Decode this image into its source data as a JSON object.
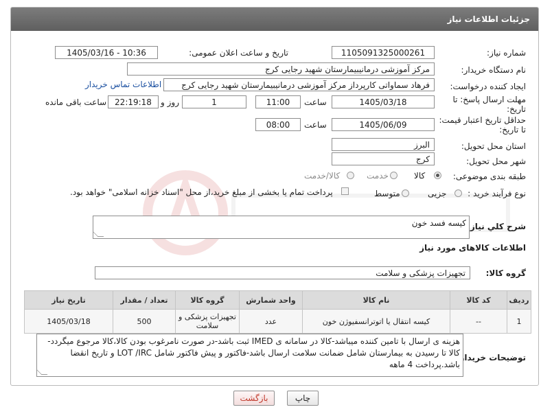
{
  "header": {
    "title": "جزئیات اطلاعات نیاز"
  },
  "fields": {
    "need_number_label": "شماره نیاز:",
    "need_number": "1105091325000261",
    "announce_label": "تاریخ و ساعت اعلان عمومی:",
    "announce_value": "1405/03/16 - 10:36",
    "buyer_label": "نام دستگاه خریدار:",
    "buyer_value": "مرکز آموزشی درمانیبیمارستان شهید رجایی کرج",
    "creator_label": "ایجاد کننده درخواست:",
    "creator_value": "فرهاد سماواتی کارپرداز مرکز آموزشی درمانیبیمارستان شهید رجایی کرج",
    "contact_link": "اطلاعات تماس خریدار",
    "deadline_label_1": "مهلت ارسال پاسخ: تا",
    "deadline_label_2": "تاریخ:",
    "deadline_date": "1405/03/18",
    "time_label": "ساعت",
    "deadline_time": "11:00",
    "days_value": "1",
    "days_label": "روز و",
    "remaining_time": "22:19:18",
    "remaining_label": "ساعت باقی مانده",
    "price_label_1": "حداقل تاریخ اعتبار قیمت:",
    "price_label_2": "تا تاریخ:",
    "price_date": "1405/06/09",
    "price_time": "08:00",
    "province_label": "استان محل تحویل:",
    "province_value": "البرز",
    "city_label": "شهر محل تحویل:",
    "city_value": "کرج",
    "category_label": "طبقه بندی موضوعی:",
    "category_options": [
      "کالا",
      "خدمت",
      "کالا/خدمت"
    ],
    "process_label": "نوع فرآیند خرید :",
    "process_options": [
      "جزیی",
      "متوسط"
    ],
    "process_note": "پرداخت تمام یا بخشی از مبلغ خرید،از محل \"اسناد خزانه اسلامی\" خواهد بود."
  },
  "description": {
    "label": "شرح کلي نياز:",
    "value": "کیسه فسد خون"
  },
  "goods": {
    "section_title": "اطلاعات کالاهای مورد نیاز",
    "group_label": "گروه کالا:",
    "group_value": "تجهیزات پزشکی و سلامت"
  },
  "table": {
    "headers": [
      "ردیف",
      "کد کالا",
      "نام کالا",
      "واحد شمارش",
      "گروه کالا",
      "تعداد / مقدار",
      "تاریخ نیاز"
    ],
    "rows": [
      [
        "1",
        "--",
        "کیسه انتقال یا اتوترانسفیوژن خون",
        "عدد",
        "تجهیزات پزشکی و سلامت",
        "500",
        "1405/03/18"
      ]
    ]
  },
  "buyer_notes": {
    "label": "توضیحات خریدار:",
    "value": "هزینه ی ارسال با تامین کننده میباشد-کالا در سامانه ی IMED ثبت باشد-در صورت نامرغوب بودن کالا،کالا مرجوع میگردد-کالا تا رسیدن به بیمارستان شامل ضمانت سلامت ارسال باشد-فاکتور و پیش فاکتور شامل LOT /IRC و تاریخ انقضا باشد.پرداخت 4 ماهه"
  },
  "buttons": {
    "print": "چاپ",
    "back": "بازگشت"
  },
  "colors": {
    "header_bg": "#6b6b6b",
    "link": "#1a4fa0",
    "back_text": "#c0392b"
  }
}
